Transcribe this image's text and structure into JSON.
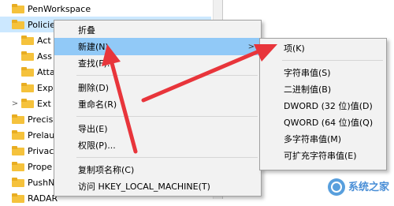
{
  "tree": {
    "items": [
      {
        "label": "PenWorkspace",
        "indent": 0,
        "expander": ""
      },
      {
        "label": "Policies",
        "indent": 0,
        "expander": "",
        "selected": true
      },
      {
        "label": "Act",
        "indent": 1,
        "expander": ""
      },
      {
        "label": "Ass",
        "indent": 1,
        "expander": ""
      },
      {
        "label": "Atta",
        "indent": 1,
        "expander": ""
      },
      {
        "label": "Exp",
        "indent": 1,
        "expander": ""
      },
      {
        "label": "Ext",
        "indent": 1,
        "expander": ">"
      },
      {
        "label": "Precis",
        "indent": 0,
        "expander": ""
      },
      {
        "label": "Prelau",
        "indent": 0,
        "expander": ""
      },
      {
        "label": "Privac",
        "indent": 0,
        "expander": ""
      },
      {
        "label": "Prope",
        "indent": 0,
        "expander": ""
      },
      {
        "label": "PushN",
        "indent": 0,
        "expander": ""
      },
      {
        "label": "RADAR",
        "indent": 0,
        "expander": ""
      }
    ]
  },
  "context_menu": {
    "items": [
      {
        "label": "折叠",
        "name": "collapse"
      },
      {
        "label": "新建(N)",
        "name": "new",
        "submenu": true,
        "highlighted": true
      },
      {
        "label": "查找(F)...",
        "name": "find"
      },
      {
        "separator": true
      },
      {
        "label": "删除(D)",
        "name": "delete"
      },
      {
        "label": "重命名(R)",
        "name": "rename"
      },
      {
        "separator": true
      },
      {
        "label": "导出(E)",
        "name": "export"
      },
      {
        "label": "权限(P)...",
        "name": "permissions"
      },
      {
        "separator": true
      },
      {
        "label": "复制项名称(C)",
        "name": "copy-key-name"
      },
      {
        "label": "访问 HKEY_LOCAL_MACHINE(T)",
        "name": "goto-hklm"
      }
    ],
    "submenu_arrow": ">"
  },
  "new_submenu": {
    "items": [
      {
        "label": "项(K)",
        "name": "key"
      },
      {
        "separator": true
      },
      {
        "label": "字符串值(S)",
        "name": "string-value"
      },
      {
        "label": "二进制值(B)",
        "name": "binary-value"
      },
      {
        "label": "DWORD (32 位)值(D)",
        "name": "dword-value"
      },
      {
        "label": "QWORD (64 位)值(Q)",
        "name": "qword-value"
      },
      {
        "label": "多字符串值(M)",
        "name": "multi-string-value"
      },
      {
        "label": "可扩充字符串值(E)",
        "name": "expandable-string-value"
      }
    ]
  },
  "watermark": {
    "text": "系统之家"
  },
  "colors": {
    "highlight": "#91c9f7",
    "arrow": "#e8353b",
    "menu_bg": "#f2f2f2"
  }
}
